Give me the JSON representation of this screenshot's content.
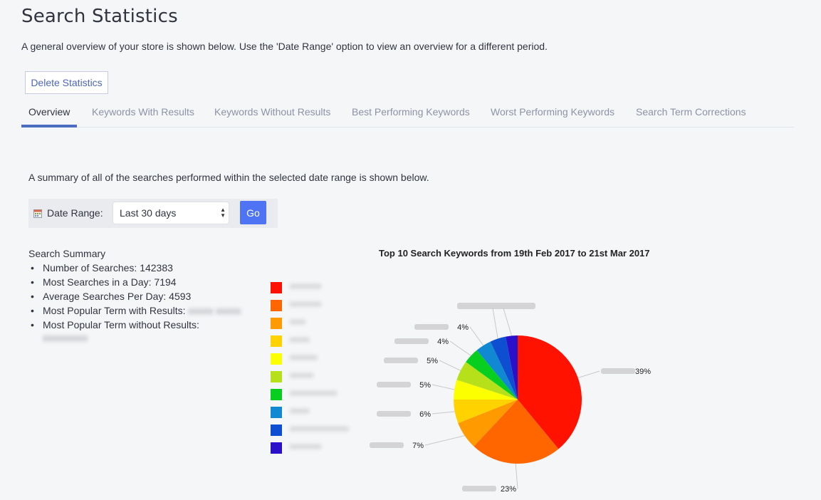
{
  "header": {
    "title": "Search Statistics",
    "intro": "A general overview of your store is shown below. Use the 'Date Range' option to view an overview for a different period.",
    "delete_label": "Delete Statistics"
  },
  "tabs": [
    {
      "label": "Overview",
      "active": true
    },
    {
      "label": "Keywords With Results",
      "active": false
    },
    {
      "label": "Keywords Without Results",
      "active": false
    },
    {
      "label": "Best Performing Keywords",
      "active": false
    },
    {
      "label": "Worst Performing Keywords",
      "active": false
    },
    {
      "label": "Search Term Corrections",
      "active": false
    }
  ],
  "overview": {
    "intro": "A summary of all of the searches performed within the selected date range is shown below.",
    "date_range_label": "Date Range:",
    "date_range_value": "Last 30 days",
    "go_label": "Go"
  },
  "summary": {
    "title": "Search Summary",
    "items": [
      {
        "label": "Number of Searches:",
        "value": "142383"
      },
      {
        "label": "Most Searches in a Day:",
        "value": "7194"
      },
      {
        "label": "Average Searches Per Day:",
        "value": "4593"
      },
      {
        "label": "Most Popular Term with Results:",
        "value": "[blurred]"
      },
      {
        "label": "Most Popular Term without Results:",
        "value": "[blurred]"
      }
    ]
  },
  "chart_data": {
    "type": "pie",
    "title": "Top 10 Search Keywords from 19th Feb 2017 to 21st Mar 2017",
    "legend_position": "left",
    "categories": [
      "[blurred 1]",
      "[blurred 2]",
      "[blurred 3]",
      "[blurred 4]",
      "[blurred 5]",
      "[blurred 6]",
      "[blurred 7]",
      "[blurred 8]",
      "[blurred 9]",
      "[blurred 10]"
    ],
    "values": [
      39,
      23,
      7,
      6,
      5,
      5,
      4,
      4,
      4,
      3
    ],
    "labels": [
      "39%",
      "23%",
      "7%",
      "6%",
      "5%",
      "5%",
      "4%",
      "4%",
      "",
      ""
    ],
    "colors": [
      "#ff1200",
      "#ff6600",
      "#ff9a00",
      "#ffd200",
      "#fcff00",
      "#b6e01a",
      "#08cf1f",
      "#1188d2",
      "#0d4fd0",
      "#2a10c8"
    ]
  }
}
